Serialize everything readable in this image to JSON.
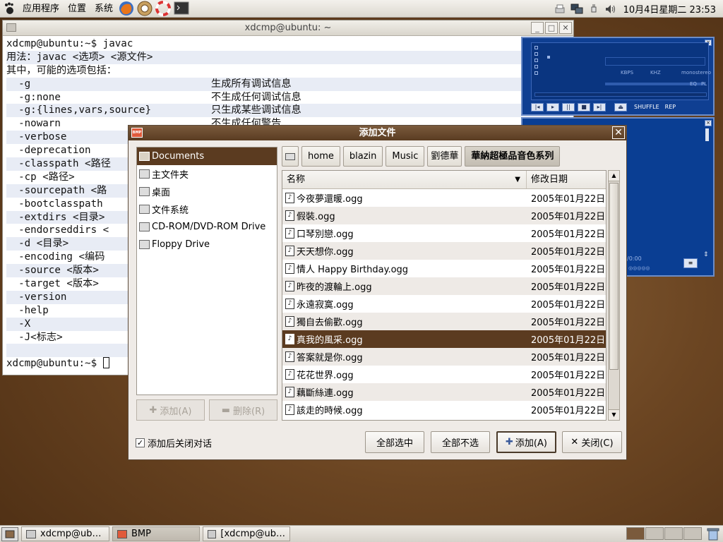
{
  "top_panel": {
    "menus": [
      "应用程序",
      "位置",
      "系统"
    ],
    "launchers": [
      "firefox-icon",
      "help-icon",
      "lifebuoy-icon",
      "terminal-icon"
    ],
    "clock": "10月4日星期二 23:53"
  },
  "terminal": {
    "title": "xdcmp@ubuntu: ~",
    "lines": [
      "xdcmp@ubuntu:~$ javac",
      "用法：javac <选项> <源文件>",
      "其中，可能的选项包括：",
      "  -g",
      "  -g:none",
      "  -g:{lines,vars,source}",
      "  -nowarn",
      "  -verbose",
      "  -deprecation",
      "  -classpath <路径",
      "  -cp <路径>",
      "  -sourcepath <路",
      "  -bootclasspath",
      "  -extdirs <目录>",
      "  -endorseddirs <",
      "  -d <目录>",
      "  -encoding <编码",
      "  -source <版本>",
      "  -target <版本>",
      "  -version",
      "  -help",
      "  -X",
      "  -J<标志>",
      "",
      "xdcmp@ubuntu:~$ "
    ],
    "descriptions": {
      "3": "生成所有调试信息",
      "4": "不生成任何调试信息",
      "5": "只生成某些调试信息",
      "6": "不生成任何警告"
    }
  },
  "bmp_player": {
    "labels": [
      "KBPS",
      "KHZ",
      "mono",
      "stereo",
      "EQ",
      "PL",
      "SHUFFLE",
      "REP"
    ],
    "time": "/0:00"
  },
  "dialog": {
    "title": "添加文件",
    "logo": "BMP",
    "places": [
      {
        "label": "Documents",
        "icon": "folder-icon",
        "selected": true
      },
      {
        "label": "主文件夹",
        "icon": "home-folder-icon",
        "selected": false
      },
      {
        "label": "桌面",
        "icon": "desktop-icon",
        "selected": false
      },
      {
        "label": "文件系统",
        "icon": "filesystem-icon",
        "selected": false
      },
      {
        "label": "CD-ROM/DVD-ROM Drive",
        "icon": "cdrom-icon",
        "selected": false
      },
      {
        "label": "Floppy Drive",
        "icon": "floppy-icon",
        "selected": false
      }
    ],
    "add_place_label": "添加(A)",
    "remove_place_label": "删除(R)",
    "path": [
      "home",
      "blazin",
      "Music",
      "劉德華",
      "華納超極品音色系列"
    ],
    "columns": {
      "name": "名称",
      "date": "修改日期"
    },
    "files": [
      {
        "name": "今夜夢還暖.ogg",
        "date": "2005年01月22日"
      },
      {
        "name": "假裝.ogg",
        "date": "2005年01月22日"
      },
      {
        "name": "口琴別戀.ogg",
        "date": "2005年01月22日"
      },
      {
        "name": "天天想你.ogg",
        "date": "2005年01月22日"
      },
      {
        "name": "情人 Happy Birthday.ogg",
        "date": "2005年01月22日"
      },
      {
        "name": "昨夜的渡輪上.ogg",
        "date": "2005年01月22日"
      },
      {
        "name": "永遠寂寞.ogg",
        "date": "2005年01月22日"
      },
      {
        "name": "獨自去偷歡.ogg",
        "date": "2005年01月22日"
      },
      {
        "name": "真我的風采.ogg",
        "date": "2005年01月22日",
        "selected": true
      },
      {
        "name": "答案就是你.ogg",
        "date": "2005年01月22日"
      },
      {
        "name": "花花世界.ogg",
        "date": "2005年01月22日"
      },
      {
        "name": "藕斷絲連.ogg",
        "date": "2005年01月22日"
      },
      {
        "name": "該走的時候.ogg",
        "date": "2005年01月22日"
      }
    ],
    "close_after_add_label": "添加后关闭对话",
    "close_after_add_checked": true,
    "select_all_label": "全部选中",
    "select_none_label": "全部不选",
    "add_label": "添加(A)",
    "close_label": "关闭(C)"
  },
  "taskbar": {
    "tasks": [
      {
        "label": "xdcmp@ub…",
        "icon": "terminal-icon"
      },
      {
        "label": "BMP",
        "icon": "bmp-icon"
      },
      {
        "label": "[xdcmp@ub…",
        "icon": "terminal-icon"
      }
    ]
  },
  "colors": {
    "selection": "#5b3b20",
    "title_bar": "#6b4a2e",
    "bmp_blue": "#0f3f92"
  }
}
